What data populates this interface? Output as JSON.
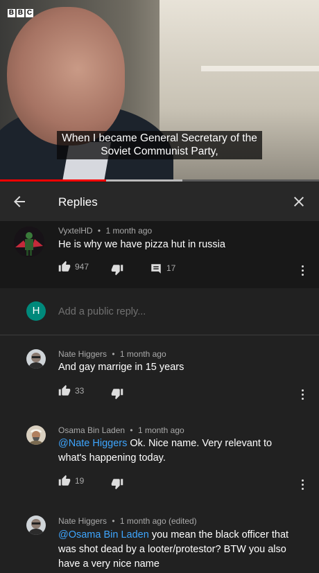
{
  "video": {
    "logo_letters": [
      "B",
      "B",
      "C"
    ],
    "subtitle": "When I became General Secretary of the Soviet Communist Party,",
    "played_fraction": 0.333,
    "buffered_fraction": 0.572
  },
  "header": {
    "title": "Replies",
    "back_icon": "arrow-left-icon",
    "close_icon": "close-icon"
  },
  "parent_comment": {
    "author": "VyxtelHD",
    "time": "1 month ago",
    "text": "He is why we have pizza hut in russia",
    "likes": "947",
    "replies": "17"
  },
  "reply_box": {
    "avatar_letter": "H",
    "placeholder": "Add a public reply...",
    "avatar_color": "#00897b"
  },
  "replies": [
    {
      "author": "Nate Higgers",
      "time": "1 month ago",
      "mention": "",
      "text": "And gay marrige in 15 years",
      "likes": "33"
    },
    {
      "author": "Osama Bin Laden",
      "time": "1 month ago",
      "mention": "@Nate Higgers",
      "text": " Ok. Nice name. Very relevant to what's happening today.",
      "likes": "19"
    },
    {
      "author": "Nate Higgers",
      "time": "1 month ago (edited)",
      "mention": "@Osama Bin Laden",
      "text": " you mean the black officer that was shot dead by a looter/protestor? BTW you also have a very nice name",
      "likes": ""
    }
  ],
  "separator": "•",
  "colors": {
    "link": "#3ea6ff",
    "progress_played": "#ff0000",
    "background": "#212121"
  }
}
